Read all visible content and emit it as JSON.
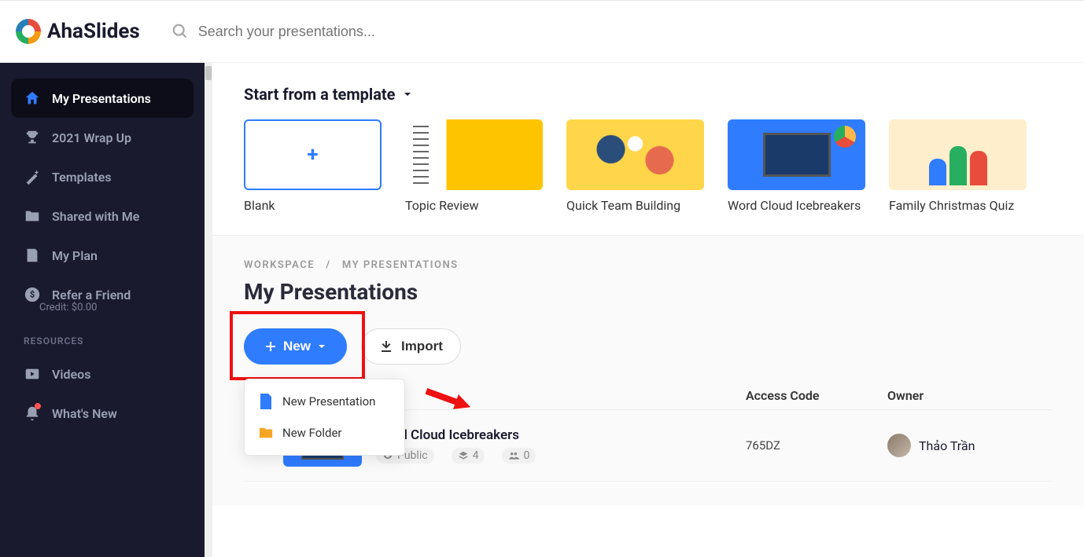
{
  "header": {
    "brand": "AhaSlides",
    "search_placeholder": "Search your presentations..."
  },
  "sidebar": {
    "items": [
      {
        "label": "My Presentations"
      },
      {
        "label": "2021 Wrap Up"
      },
      {
        "label": "Templates"
      },
      {
        "label": "Shared with Me"
      },
      {
        "label": "My Plan"
      },
      {
        "label": "Refer a Friend"
      }
    ],
    "credit": "Credit: $0.00",
    "resources_head": "RESOURCES",
    "resources": [
      {
        "label": "Videos"
      },
      {
        "label": "What's New"
      }
    ]
  },
  "templates": {
    "title": "Start from a template",
    "cards": [
      {
        "label": "Blank"
      },
      {
        "label": "Topic Review"
      },
      {
        "label": "Quick Team Building"
      },
      {
        "label": "Word Cloud Icebreakers"
      },
      {
        "label": "Family Christmas Quiz"
      }
    ]
  },
  "breadcrumb": {
    "root": "WORKSPACE",
    "sep": "/",
    "current": "MY PRESENTATIONS"
  },
  "page_title": "My Presentations",
  "actions": {
    "new_label": "New",
    "import_label": "Import",
    "dropdown": [
      {
        "label": "New Presentation"
      },
      {
        "label": "New Folder"
      }
    ]
  },
  "table": {
    "head_code": "Access Code",
    "head_owner": "Owner",
    "rows": [
      {
        "title": "Word Cloud Icebreakers",
        "visibility": "Public",
        "slides": "4",
        "participants": "0",
        "code": "765DZ",
        "owner": "Thảo Trần"
      }
    ]
  }
}
